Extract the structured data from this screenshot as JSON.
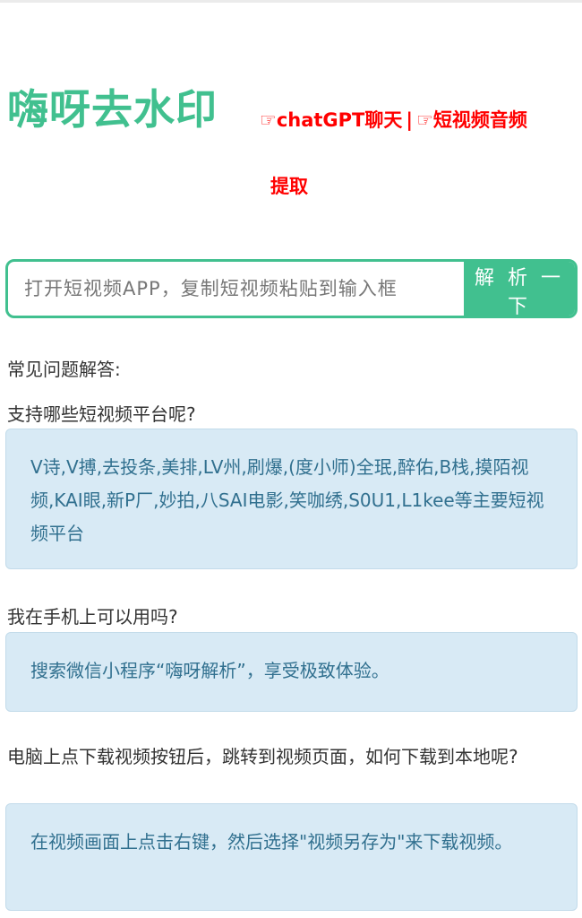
{
  "header": {
    "brand": "嗨呀去水印",
    "link_chatgpt": "☞chatGPT聊天",
    "separator": "|",
    "link_audio_line1": "☞短视频音频",
    "link_audio_line2": "提取"
  },
  "search": {
    "placeholder": "打开短视频APP，复制短视频粘贴到输入框",
    "button_label": "解 析 一 下"
  },
  "faq": {
    "title": "常见问题解答:",
    "items": [
      {
        "question": "支持哪些短视频平台呢?",
        "answer": "V诗,V搏,去投条,美排,LV州,刷爆,(度小师)全珉,醉佑,B栈,摸陌视频,KAI眼,新P厂,妙拍,八SAI电影,笑咖绣,S0U1,L1kee等主要短视频平台"
      },
      {
        "question": "我在手机上可以用吗?",
        "answer": "搜索微信小程序“嗨呀解析”，享受极致体验。"
      },
      {
        "question": "电脑上点下载视频按钮后，跳转到视频页面，如何下载到本地呢?",
        "answer": "在视频画面上点击右键，然后选择\"视频另存为\"来下载视频。"
      }
    ]
  },
  "colors": {
    "brand_green": "#41c08f",
    "link_red": "#ff0000",
    "answer_bg": "#d8eaf5",
    "answer_text": "#31708f"
  }
}
